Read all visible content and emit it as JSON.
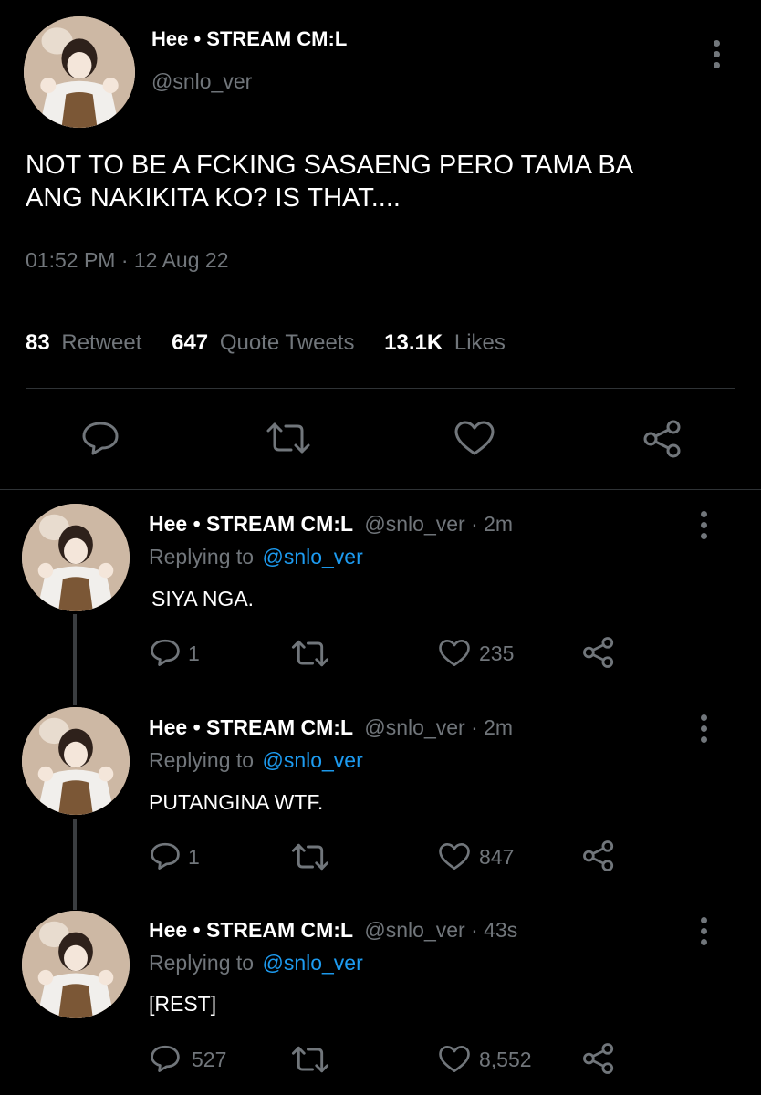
{
  "main_tweet": {
    "display_name": "Hee • STREAM CM:L",
    "handle": "@snlo_ver",
    "text_line1": "NOT TO BE A FCKING SASAENG PERO TAMA BA",
    "text_line2": "ANG NAKIKITA KO? IS THAT....",
    "timestamp": "01:52 PM · 12 Aug 22",
    "stats": {
      "retweets_count": "83",
      "retweets_label": "Retweet",
      "quotes_count": "647",
      "quotes_label": "Quote Tweets",
      "likes_count": "13.1K",
      "likes_label": "Likes"
    },
    "action_icons": [
      "reply-icon",
      "retweet-icon",
      "like-icon",
      "share-icon"
    ]
  },
  "replies": [
    {
      "display_name": "Hee • STREAM CM:L",
      "handle_time": "@snlo_ver · 2m",
      "replying_prefix": "Replying to",
      "replying_to": "@snlo_ver",
      "text": "SIYA NGA.",
      "reply_count": "1",
      "retweet_count": "",
      "like_count": "235"
    },
    {
      "display_name": "Hee • STREAM CM:L",
      "handle_time": "@snlo_ver · 2m",
      "replying_prefix": "Replying to",
      "replying_to": "@snlo_ver",
      "text": "PUTANGINA WTF.",
      "reply_count": "1",
      "retweet_count": "",
      "like_count": "847"
    },
    {
      "display_name": "Hee • STREAM CM:L",
      "handle_time": "@snlo_ver · 43s",
      "replying_prefix": "Replying to",
      "replying_to": "@snlo_ver",
      "text": "[REST]",
      "reply_count": "527",
      "retweet_count": "",
      "like_count": "8,552"
    }
  ],
  "colors": {
    "background": "#000000",
    "muted": "#71767b",
    "link": "#1d9bf0",
    "divider": "#2f3336"
  }
}
